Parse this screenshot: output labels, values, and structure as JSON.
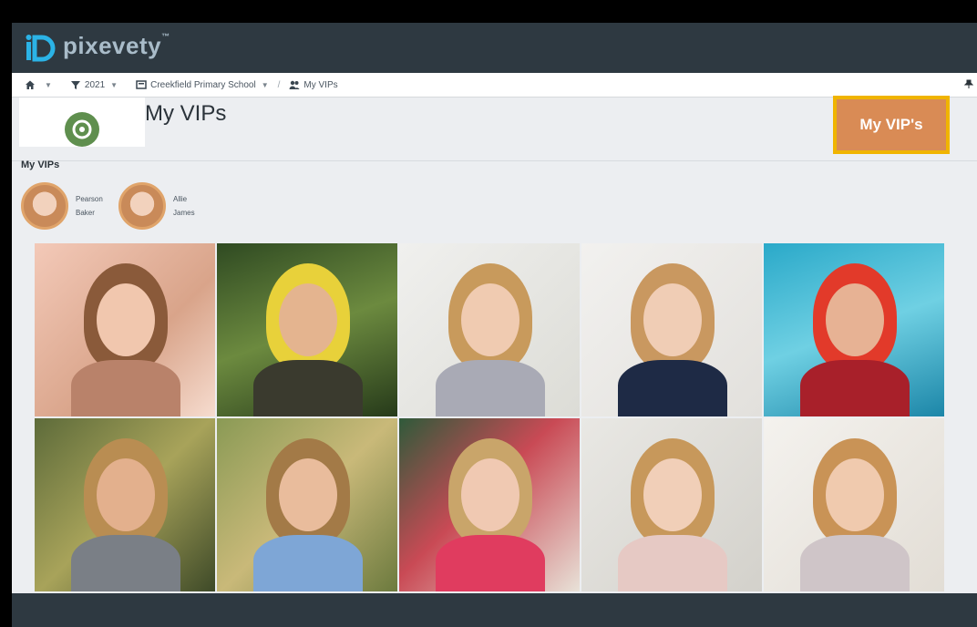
{
  "app": {
    "logo_text": "pixevety",
    "logo_tm": "™"
  },
  "breadcrumb": {
    "items": [
      {
        "label": "",
        "icon": "home-icon"
      },
      {
        "label": "2021",
        "icon": "filter-icon"
      },
      {
        "label": "Creekfield Primary School",
        "icon": "school-icon"
      },
      {
        "label": "My VIPs",
        "icon": "users-icon"
      }
    ]
  },
  "header": {
    "title": "My VIPs",
    "vip_button": "My VIP's"
  },
  "section": {
    "label": "My VIPs"
  },
  "vips": [
    {
      "first": "Pearson",
      "last": "Baker"
    },
    {
      "first": "Allie",
      "last": "James"
    }
  ],
  "colors": {
    "appbar": "#2e3941",
    "accent": "#d98b55",
    "highlight": "#f0b400"
  },
  "photos": [
    {
      "bg": "linear-gradient(135deg,#f3c9b8,#d9a48a 60%,#f6dccf)",
      "hair": "#8a5a3a",
      "skin": "#f1c7ae",
      "cloth": "#b9826a"
    },
    {
      "bg": "linear-gradient(160deg,#2f4a22,#6c8a3f 50%,#263a1a)",
      "hair": "#e8d13a",
      "skin": "#e4b48f",
      "cloth": "#3a3a2e"
    },
    {
      "bg": "linear-gradient(135deg,#f0f0ee,#dcdcd6)",
      "hair": "#c89a5c",
      "skin": "#f0cbb1",
      "cloth": "#a9aab5"
    },
    {
      "bg": "linear-gradient(135deg,#f2f1ef,#e2e0dc)",
      "hair": "#c99860",
      "skin": "#f0cdb5",
      "cloth": "#1e2a45"
    },
    {
      "bg": "linear-gradient(160deg,#2aa9c9,#6fd0e3 50%,#1c86a8)",
      "hair": "#e23a2a",
      "skin": "#e7b294",
      "cloth": "#a8202a"
    },
    {
      "bg": "linear-gradient(135deg,#5d6b3a,#a8a35a 50%,#3e4a28)",
      "hair": "#b98d52",
      "skin": "#e3b08d",
      "cloth": "#7a7f86"
    },
    {
      "bg": "linear-gradient(135deg,#8a9a55,#c9b979 50%,#6c7a3e)",
      "hair": "#a37a47",
      "skin": "#e9bc9c",
      "cloth": "#7ea6d6"
    },
    {
      "bg": "linear-gradient(135deg,#2f5a3a,#c94a55 45%,#e8e2d8)",
      "hair": "#c9a56a",
      "skin": "#f0c9b2",
      "cloth": "#e03c5f"
    },
    {
      "bg": "linear-gradient(135deg,#e9e8e4,#d3d1cb)",
      "hair": "#c7985b",
      "skin": "#f1cfb8",
      "cloth": "#e6c9c4"
    },
    {
      "bg": "linear-gradient(135deg,#f4f2ee,#e2ddd5)",
      "hair": "#c99356",
      "skin": "#f0caae",
      "cloth": "#cfc5c8"
    }
  ]
}
